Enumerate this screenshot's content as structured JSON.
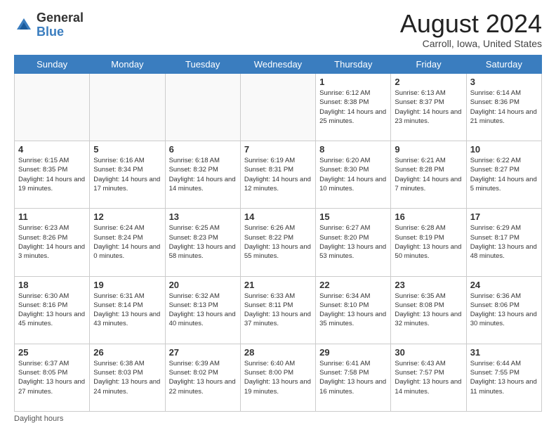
{
  "logo": {
    "general": "General",
    "blue": "Blue"
  },
  "title": {
    "month_year": "August 2024",
    "location": "Carroll, Iowa, United States"
  },
  "weekdays": [
    "Sunday",
    "Monday",
    "Tuesday",
    "Wednesday",
    "Thursday",
    "Friday",
    "Saturday"
  ],
  "weeks": [
    [
      {
        "day": "",
        "info": ""
      },
      {
        "day": "",
        "info": ""
      },
      {
        "day": "",
        "info": ""
      },
      {
        "day": "",
        "info": ""
      },
      {
        "day": "1",
        "info": "Sunrise: 6:12 AM\nSunset: 8:38 PM\nDaylight: 14 hours and 25 minutes."
      },
      {
        "day": "2",
        "info": "Sunrise: 6:13 AM\nSunset: 8:37 PM\nDaylight: 14 hours and 23 minutes."
      },
      {
        "day": "3",
        "info": "Sunrise: 6:14 AM\nSunset: 8:36 PM\nDaylight: 14 hours and 21 minutes."
      }
    ],
    [
      {
        "day": "4",
        "info": "Sunrise: 6:15 AM\nSunset: 8:35 PM\nDaylight: 14 hours and 19 minutes."
      },
      {
        "day": "5",
        "info": "Sunrise: 6:16 AM\nSunset: 8:34 PM\nDaylight: 14 hours and 17 minutes."
      },
      {
        "day": "6",
        "info": "Sunrise: 6:18 AM\nSunset: 8:32 PM\nDaylight: 14 hours and 14 minutes."
      },
      {
        "day": "7",
        "info": "Sunrise: 6:19 AM\nSunset: 8:31 PM\nDaylight: 14 hours and 12 minutes."
      },
      {
        "day": "8",
        "info": "Sunrise: 6:20 AM\nSunset: 8:30 PM\nDaylight: 14 hours and 10 minutes."
      },
      {
        "day": "9",
        "info": "Sunrise: 6:21 AM\nSunset: 8:28 PM\nDaylight: 14 hours and 7 minutes."
      },
      {
        "day": "10",
        "info": "Sunrise: 6:22 AM\nSunset: 8:27 PM\nDaylight: 14 hours and 5 minutes."
      }
    ],
    [
      {
        "day": "11",
        "info": "Sunrise: 6:23 AM\nSunset: 8:26 PM\nDaylight: 14 hours and 3 minutes."
      },
      {
        "day": "12",
        "info": "Sunrise: 6:24 AM\nSunset: 8:24 PM\nDaylight: 14 hours and 0 minutes."
      },
      {
        "day": "13",
        "info": "Sunrise: 6:25 AM\nSunset: 8:23 PM\nDaylight: 13 hours and 58 minutes."
      },
      {
        "day": "14",
        "info": "Sunrise: 6:26 AM\nSunset: 8:22 PM\nDaylight: 13 hours and 55 minutes."
      },
      {
        "day": "15",
        "info": "Sunrise: 6:27 AM\nSunset: 8:20 PM\nDaylight: 13 hours and 53 minutes."
      },
      {
        "day": "16",
        "info": "Sunrise: 6:28 AM\nSunset: 8:19 PM\nDaylight: 13 hours and 50 minutes."
      },
      {
        "day": "17",
        "info": "Sunrise: 6:29 AM\nSunset: 8:17 PM\nDaylight: 13 hours and 48 minutes."
      }
    ],
    [
      {
        "day": "18",
        "info": "Sunrise: 6:30 AM\nSunset: 8:16 PM\nDaylight: 13 hours and 45 minutes."
      },
      {
        "day": "19",
        "info": "Sunrise: 6:31 AM\nSunset: 8:14 PM\nDaylight: 13 hours and 43 minutes."
      },
      {
        "day": "20",
        "info": "Sunrise: 6:32 AM\nSunset: 8:13 PM\nDaylight: 13 hours and 40 minutes."
      },
      {
        "day": "21",
        "info": "Sunrise: 6:33 AM\nSunset: 8:11 PM\nDaylight: 13 hours and 37 minutes."
      },
      {
        "day": "22",
        "info": "Sunrise: 6:34 AM\nSunset: 8:10 PM\nDaylight: 13 hours and 35 minutes."
      },
      {
        "day": "23",
        "info": "Sunrise: 6:35 AM\nSunset: 8:08 PM\nDaylight: 13 hours and 32 minutes."
      },
      {
        "day": "24",
        "info": "Sunrise: 6:36 AM\nSunset: 8:06 PM\nDaylight: 13 hours and 30 minutes."
      }
    ],
    [
      {
        "day": "25",
        "info": "Sunrise: 6:37 AM\nSunset: 8:05 PM\nDaylight: 13 hours and 27 minutes."
      },
      {
        "day": "26",
        "info": "Sunrise: 6:38 AM\nSunset: 8:03 PM\nDaylight: 13 hours and 24 minutes."
      },
      {
        "day": "27",
        "info": "Sunrise: 6:39 AM\nSunset: 8:02 PM\nDaylight: 13 hours and 22 minutes."
      },
      {
        "day": "28",
        "info": "Sunrise: 6:40 AM\nSunset: 8:00 PM\nDaylight: 13 hours and 19 minutes."
      },
      {
        "day": "29",
        "info": "Sunrise: 6:41 AM\nSunset: 7:58 PM\nDaylight: 13 hours and 16 minutes."
      },
      {
        "day": "30",
        "info": "Sunrise: 6:43 AM\nSunset: 7:57 PM\nDaylight: 13 hours and 14 minutes."
      },
      {
        "day": "31",
        "info": "Sunrise: 6:44 AM\nSunset: 7:55 PM\nDaylight: 13 hours and 11 minutes."
      }
    ]
  ],
  "footer": {
    "daylight_label": "Daylight hours"
  }
}
